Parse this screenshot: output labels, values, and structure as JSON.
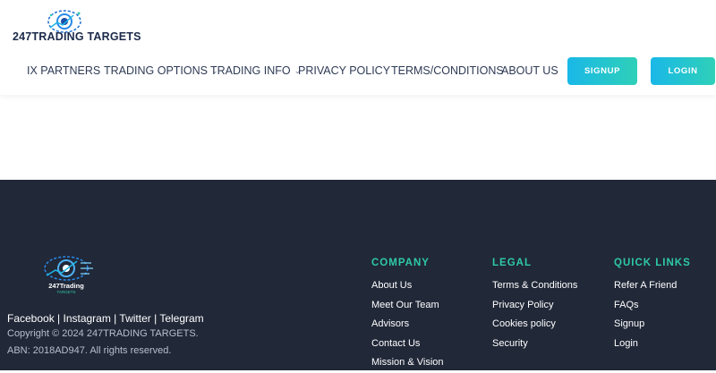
{
  "header": {
    "brand": "247TRADING TARGETS",
    "nav": [
      {
        "label": "IX PARTNERS",
        "dropdown": false
      },
      {
        "label": "TRADING OPTIONS",
        "dropdown": true
      },
      {
        "label": "TRADING INFO",
        "dropdown": true
      },
      {
        "label": "PRIVACY POLICY",
        "dropdown": false
      },
      {
        "label": "TERMS/CONDITIONS",
        "dropdown": false
      },
      {
        "label": "ABOUT US",
        "dropdown": false
      }
    ],
    "signup_label": "SIGNUP",
    "login_label": "LOGIN",
    "chevron": "⌄"
  },
  "footer": {
    "logo_text": "247Trading",
    "logo_subtext": "TARGETS",
    "social": "Facebook | Instagram | Twitter | Telegram",
    "copyright": "Copyright © 2024 247TRADING TARGETS.",
    "abn": "ABN: 2018AD947. All rights reserved.",
    "company": {
      "title": "COMPANY",
      "links": [
        "About Us",
        "Meet Our Team",
        "Advisors",
        "Contact Us",
        "Mission & Vision"
      ]
    },
    "legal": {
      "title": "LEGAL",
      "links": [
        "Terms & Conditions",
        "Privacy Policy",
        "Cookies policy",
        "Security"
      ]
    },
    "quick": {
      "title": "QUICK LINKS",
      "links": [
        "Refer A Friend",
        "FAQs",
        "Signup",
        "Login"
      ]
    }
  },
  "colors": {
    "footer_bg": "#212838",
    "accent_teal": "#2ec9a8",
    "button_gradient_start": "#19b8e8",
    "button_gradient_end": "#2fd0b8",
    "nav_text": "#2e3a55"
  }
}
